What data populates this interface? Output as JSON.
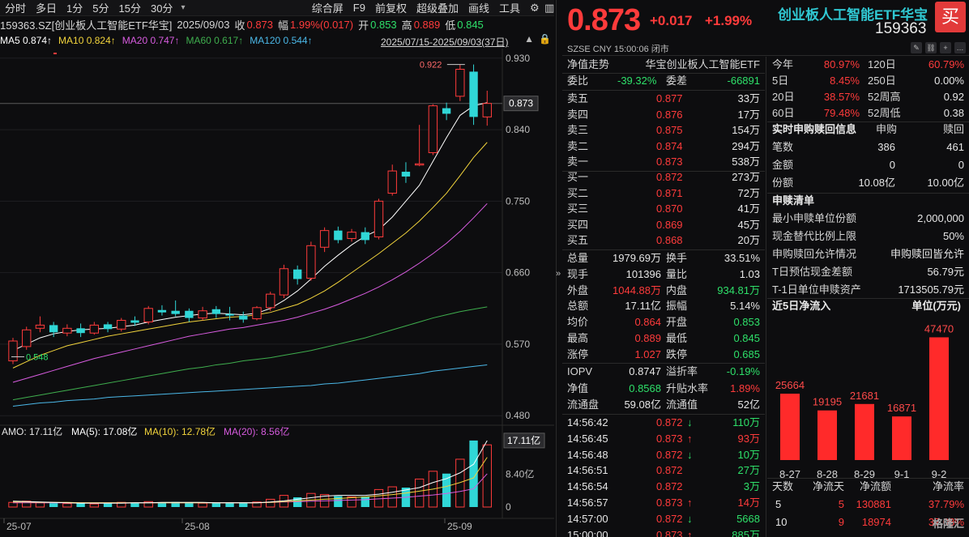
{
  "toolbar": {
    "left": [
      "分时",
      "多日",
      "1分",
      "5分",
      "15分",
      "30分"
    ],
    "right": [
      "综合屏",
      "F9",
      "前复权",
      "超级叠加",
      "画线",
      "工具"
    ]
  },
  "info": {
    "name": "159363.SZ[创业板人工智能ETF华宝]",
    "date": "2025/09/03",
    "close_label": "收",
    "close": "0.873",
    "amp_label": "幅",
    "amp": "1.99%(0.017)",
    "open_label": "开",
    "open": "0.853",
    "high_label": "高",
    "high": "0.889",
    "low_label": "低",
    "low": "0.845"
  },
  "ma": {
    "ma5": "MA5 0.874↑",
    "ma10": "MA10 0.824↑",
    "ma20": "MA20 0.747↑",
    "ma60": "MA60 0.617↑",
    "ma120": "MA120 0.544↑",
    "range": "2025/07/15-2025/09/03(37日)"
  },
  "colors": {
    "up": "#ff3b3b",
    "down": "#30d7d7",
    "ma5": "#ffffff",
    "ma10": "#f2d43c",
    "ma20": "#d85ce0",
    "ma60": "#3fae4e",
    "ma120": "#4bb8e8"
  },
  "chart_data": {
    "type": "candlestick",
    "price_axis": {
      "labels": [
        "0.930",
        "0.840",
        "0.750",
        "0.660",
        "0.570",
        "0.480"
      ],
      "current": "0.873",
      "max_label": "0.922",
      "min_label": "0.548"
    },
    "volume": {
      "title": "AMO: 17.11亿",
      "ma5": "MA(5): 17.08亿",
      "ma10": "MA(10): 12.78亿",
      "ma20": "MA(20): 8.56亿",
      "axis": [
        "17.11亿",
        "8.40亿",
        "0"
      ]
    },
    "x_labels": [
      "25-07",
      "25-08",
      "25-09"
    ],
    "candles": [
      {
        "o": 0.549,
        "c": 0.574,
        "h": 0.578,
        "l": 0.545,
        "v": 1.2
      },
      {
        "o": 0.567,
        "c": 0.588,
        "h": 0.592,
        "l": 0.563,
        "v": 1.5
      },
      {
        "o": 0.59,
        "c": 0.594,
        "h": 0.605,
        "l": 0.585,
        "v": 1.1
      },
      {
        "o": 0.594,
        "c": 0.585,
        "h": 0.598,
        "l": 0.579,
        "v": 1.0
      },
      {
        "o": 0.584,
        "c": 0.59,
        "h": 0.595,
        "l": 0.58,
        "v": 0.9
      },
      {
        "o": 0.59,
        "c": 0.584,
        "h": 0.596,
        "l": 0.579,
        "v": 1.0
      },
      {
        "o": 0.584,
        "c": 0.594,
        "h": 0.598,
        "l": 0.582,
        "v": 0.8
      },
      {
        "o": 0.595,
        "c": 0.589,
        "h": 0.598,
        "l": 0.585,
        "v": 0.9
      },
      {
        "o": 0.589,
        "c": 0.6,
        "h": 0.603,
        "l": 0.586,
        "v": 1.2
      },
      {
        "o": 0.6,
        "c": 0.597,
        "h": 0.605,
        "l": 0.593,
        "v": 1.0
      },
      {
        "o": 0.598,
        "c": 0.615,
        "h": 0.618,
        "l": 0.595,
        "v": 1.4
      },
      {
        "o": 0.613,
        "c": 0.61,
        "h": 0.619,
        "l": 0.606,
        "v": 1.1
      },
      {
        "o": 0.612,
        "c": 0.608,
        "h": 0.625,
        "l": 0.605,
        "v": 1.3
      },
      {
        "o": 0.612,
        "c": 0.603,
        "h": 0.615,
        "l": 0.598,
        "v": 1.2
      },
      {
        "o": 0.603,
        "c": 0.612,
        "h": 0.617,
        "l": 0.6,
        "v": 1.0
      },
      {
        "o": 0.614,
        "c": 0.608,
        "h": 0.618,
        "l": 0.603,
        "v": 1.1
      },
      {
        "o": 0.608,
        "c": 0.606,
        "h": 0.617,
        "l": 0.6,
        "v": 1.0
      },
      {
        "o": 0.606,
        "c": 0.601,
        "h": 0.611,
        "l": 0.597,
        "v": 1.0
      },
      {
        "o": 0.602,
        "c": 0.616,
        "h": 0.618,
        "l": 0.6,
        "v": 1.3
      },
      {
        "o": 0.616,
        "c": 0.633,
        "h": 0.636,
        "l": 0.612,
        "v": 2.0
      },
      {
        "o": 0.632,
        "c": 0.665,
        "h": 0.67,
        "l": 0.628,
        "v": 3.0
      },
      {
        "o": 0.664,
        "c": 0.652,
        "h": 0.669,
        "l": 0.645,
        "v": 2.5
      },
      {
        "o": 0.653,
        "c": 0.694,
        "h": 0.699,
        "l": 0.65,
        "v": 3.5
      },
      {
        "o": 0.692,
        "c": 0.713,
        "h": 0.717,
        "l": 0.686,
        "v": 3.2
      },
      {
        "o": 0.713,
        "c": 0.701,
        "h": 0.718,
        "l": 0.697,
        "v": 2.8
      },
      {
        "o": 0.703,
        "c": 0.711,
        "h": 0.715,
        "l": 0.699,
        "v": 2.6
      },
      {
        "o": 0.711,
        "c": 0.701,
        "h": 0.717,
        "l": 0.696,
        "v": 2.7
      },
      {
        "o": 0.705,
        "c": 0.75,
        "h": 0.753,
        "l": 0.702,
        "v": 4.5
      },
      {
        "o": 0.76,
        "c": 0.788,
        "h": 0.796,
        "l": 0.757,
        "v": 5.2
      },
      {
        "o": 0.787,
        "c": 0.781,
        "h": 0.799,
        "l": 0.773,
        "v": 5.0
      },
      {
        "o": 0.797,
        "c": 0.797,
        "h": 0.846,
        "l": 0.794,
        "v": 7.2
      },
      {
        "o": 0.811,
        "c": 0.87,
        "h": 0.872,
        "l": 0.808,
        "v": 9.2
      },
      {
        "o": 0.867,
        "c": 0.86,
        "h": 0.874,
        "l": 0.852,
        "v": 8.6
      },
      {
        "o": 0.882,
        "c": 0.916,
        "h": 0.922,
        "l": 0.876,
        "v": 12.3
      },
      {
        "o": 0.913,
        "c": 0.856,
        "h": 0.922,
        "l": 0.846,
        "v": 17.11
      },
      {
        "o": 0.856,
        "c": 0.873,
        "h": 0.889,
        "l": 0.845,
        "v": 16.0
      }
    ],
    "ma_series": {
      "ma5": [
        0.562,
        0.57,
        0.578,
        0.583,
        0.586,
        0.588,
        0.589,
        0.59,
        0.592,
        0.594,
        0.598,
        0.601,
        0.604,
        0.606,
        0.608,
        0.609,
        0.608,
        0.607,
        0.609,
        0.615,
        0.625,
        0.637,
        0.652,
        0.668,
        0.682,
        0.695,
        0.706,
        0.714,
        0.73,
        0.75,
        0.77,
        0.8,
        0.83,
        0.858,
        0.87,
        0.874
      ],
      "ma10": [
        0.54,
        0.548,
        0.556,
        0.562,
        0.568,
        0.572,
        0.576,
        0.58,
        0.583,
        0.586,
        0.589,
        0.592,
        0.595,
        0.598,
        0.6,
        0.602,
        0.604,
        0.605,
        0.607,
        0.61,
        0.615,
        0.62,
        0.628,
        0.637,
        0.648,
        0.66,
        0.672,
        0.684,
        0.697,
        0.71,
        0.725,
        0.742,
        0.76,
        0.782,
        0.805,
        0.824
      ],
      "ma20": [
        0.522,
        0.527,
        0.532,
        0.537,
        0.542,
        0.547,
        0.552,
        0.556,
        0.56,
        0.564,
        0.568,
        0.572,
        0.576,
        0.58,
        0.583,
        0.586,
        0.589,
        0.591,
        0.594,
        0.597,
        0.6,
        0.604,
        0.609,
        0.614,
        0.62,
        0.627,
        0.634,
        0.642,
        0.651,
        0.661,
        0.672,
        0.684,
        0.697,
        0.712,
        0.729,
        0.747
      ],
      "ma60": [
        0.5,
        0.503,
        0.506,
        0.509,
        0.512,
        0.515,
        0.518,
        0.521,
        0.524,
        0.527,
        0.53,
        0.533,
        0.536,
        0.539,
        0.541,
        0.544,
        0.546,
        0.549,
        0.551,
        0.553,
        0.556,
        0.559,
        0.562,
        0.566,
        0.57,
        0.574,
        0.578,
        0.583,
        0.588,
        0.593,
        0.598,
        0.603,
        0.607,
        0.611,
        0.614,
        0.617
      ],
      "ma120": [
        0.492,
        0.494,
        0.496,
        0.497,
        0.499,
        0.5,
        0.501,
        0.503,
        0.504,
        0.505,
        0.506,
        0.507,
        0.508,
        0.509,
        0.51,
        0.511,
        0.512,
        0.513,
        0.514,
        0.515,
        0.516,
        0.517,
        0.518,
        0.52,
        0.521,
        0.523,
        0.525,
        0.527,
        0.529,
        0.531,
        0.533,
        0.536,
        0.538,
        0.54,
        0.542,
        0.544
      ]
    },
    "vol_ma": {
      "ma5": [
        1.5,
        1.4,
        1.3,
        1.2,
        1.1,
        1.0,
        1.0,
        1.0,
        1.0,
        1.1,
        1.1,
        1.2,
        1.2,
        1.2,
        1.2,
        1.1,
        1.1,
        1.1,
        1.1,
        1.3,
        1.6,
        2.0,
        2.4,
        2.8,
        3.0,
        3.0,
        3.0,
        3.3,
        3.8,
        4.4,
        5.0,
        6.3,
        7.3,
        8.8,
        11.0,
        17.08
      ],
      "ma10": [
        1.3,
        1.3,
        1.2,
        1.2,
        1.2,
        1.1,
        1.1,
        1.1,
        1.1,
        1.1,
        1.1,
        1.1,
        1.1,
        1.1,
        1.1,
        1.1,
        1.1,
        1.1,
        1.1,
        1.2,
        1.4,
        1.6,
        1.8,
        2.0,
        2.2,
        2.4,
        2.6,
        2.9,
        3.2,
        3.6,
        4.1,
        4.6,
        5.3,
        6.3,
        7.5,
        12.78
      ],
      "ma20": [
        1.1,
        1.1,
        1.1,
        1.1,
        1.1,
        1.1,
        1.1,
        1.1,
        1.1,
        1.1,
        1.1,
        1.1,
        1.1,
        1.1,
        1.1,
        1.1,
        1.1,
        1.1,
        1.1,
        1.2,
        1.3,
        1.4,
        1.5,
        1.6,
        1.7,
        1.8,
        1.9,
        2.1,
        2.3,
        2.5,
        2.8,
        3.1,
        3.5,
        4.0,
        4.7,
        8.56
      ]
    }
  },
  "quote": {
    "price": "0.873",
    "change": "+0.017",
    "pct": "+1.99%",
    "name": "创业板人工智能ETF华宝",
    "code": "159363",
    "buy": "买",
    "status": "SZSE   CNY   15:00:06   闭市"
  },
  "book": {
    "title_l": "净值走势",
    "title_r": "华宝创业板人工智能ETF",
    "wb": {
      "l": "委比",
      "v": "-39.32%",
      "l2": "委差",
      "v2": "-66891"
    },
    "asks": [
      {
        "l": "卖五",
        "p": "0.877",
        "q": "33万"
      },
      {
        "l": "卖四",
        "p": "0.876",
        "q": "17万"
      },
      {
        "l": "卖三",
        "p": "0.875",
        "q": "154万"
      },
      {
        "l": "卖二",
        "p": "0.874",
        "q": "294万"
      },
      {
        "l": "卖一",
        "p": "0.873",
        "q": "538万"
      }
    ],
    "bids": [
      {
        "l": "买一",
        "p": "0.872",
        "q": "273万"
      },
      {
        "l": "买二",
        "p": "0.871",
        "q": "72万"
      },
      {
        "l": "买三",
        "p": "0.870",
        "q": "41万"
      },
      {
        "l": "买四",
        "p": "0.869",
        "q": "45万"
      },
      {
        "l": "买五",
        "p": "0.868",
        "q": "20万"
      }
    ],
    "stats": [
      {
        "l": "总量",
        "v": "1979.69万",
        "l2": "换手",
        "v2": "33.51%",
        "c": "white",
        "c2": "white"
      },
      {
        "l": "现手",
        "v": "101396",
        "l2": "量比",
        "v2": "1.03",
        "c": "white",
        "c2": "white"
      },
      {
        "l": "外盘",
        "v": "1044.88万",
        "l2": "内盘",
        "v2": "934.81万",
        "c": "red",
        "c2": "green"
      },
      {
        "l": "总额",
        "v": "17.11亿",
        "l2": "振幅",
        "v2": "5.14%",
        "c": "white",
        "c2": "white"
      },
      {
        "l": "均价",
        "v": "0.864",
        "l2": "开盘",
        "v2": "0.853",
        "c": "red",
        "c2": "green"
      },
      {
        "l": "最高",
        "v": "0.889",
        "l2": "最低",
        "v2": "0.845",
        "c": "red",
        "c2": "green"
      },
      {
        "l": "涨停",
        "v": "1.027",
        "l2": "跌停",
        "v2": "0.685",
        "c": "red",
        "c2": "green"
      }
    ],
    "iopv": [
      {
        "l": "IOPV",
        "v": "0.8747",
        "l2": "溢折率",
        "v2": "-0.19%",
        "c": "white",
        "c2": "green"
      },
      {
        "l": "净值",
        "v": "0.8568",
        "l2": "升贴水率",
        "v2": "1.89%",
        "c": "green",
        "c2": "red"
      },
      {
        "l": "流通盘",
        "v": "59.08亿",
        "l2": "流通值",
        "v2": "52亿",
        "c": "white",
        "c2": "white"
      }
    ],
    "ticks": [
      {
        "t": "14:56:42",
        "p": "0.872",
        "a": "↓",
        "q": "110万",
        "ac": "green",
        "qc": "green"
      },
      {
        "t": "14:56:45",
        "p": "0.873",
        "a": "↑",
        "q": "93万",
        "ac": "red",
        "qc": "red"
      },
      {
        "t": "14:56:48",
        "p": "0.872",
        "a": "↓",
        "q": "10万",
        "ac": "green",
        "qc": "green"
      },
      {
        "t": "14:56:51",
        "p": "0.872",
        "a": "",
        "q": "27万",
        "ac": "green",
        "qc": "green"
      },
      {
        "t": "14:56:54",
        "p": "0.872",
        "a": "",
        "q": "3万",
        "ac": "green",
        "qc": "green"
      },
      {
        "t": "14:56:57",
        "p": "0.873",
        "a": "↑",
        "q": "14万",
        "ac": "red",
        "qc": "red"
      },
      {
        "t": "14:57:00",
        "p": "0.872",
        "a": "↓",
        "q": "5668",
        "ac": "green",
        "qc": "green"
      },
      {
        "t": "15:00:00",
        "p": "0.873",
        "a": "↑",
        "q": "885万",
        "ac": "red",
        "qc": "green"
      }
    ]
  },
  "side": {
    "perf": [
      {
        "l": "今年",
        "v": "80.97%",
        "l2": "120日",
        "v2": "60.79%",
        "c": "red",
        "c2": "red"
      },
      {
        "l": "5日",
        "v": "8.45%",
        "l2": "250日",
        "v2": "0.00%",
        "c": "red",
        "c2": "white"
      },
      {
        "l": "20日",
        "v": "38.57%",
        "l2": "52周高",
        "v2": "0.92",
        "c": "red",
        "c2": "white"
      },
      {
        "l": "60日",
        "v": "79.48%",
        "l2": "52周低",
        "v2": "0.38",
        "c": "red",
        "c2": "white"
      }
    ],
    "realtime": {
      "title": "实时申购赎回信息",
      "h1": "申购",
      "h2": "赎回",
      "rows": [
        {
          "l": "笔数",
          "v": "386",
          "v2": "461"
        },
        {
          "l": "金额",
          "v": "0",
          "v2": "0"
        },
        {
          "l": "份额",
          "v": "10.08亿",
          "v2": "10.00亿"
        }
      ]
    },
    "list": {
      "title": "申赎清单",
      "rows": [
        {
          "l": "最小申赎单位份额",
          "v": "2,000,000"
        },
        {
          "l": "现金替代比例上限",
          "v": "50%"
        },
        {
          "l": "申购赎回允许情况",
          "v": "申购赎回皆允许"
        },
        {
          "l": "T日预估现金差额",
          "v": "56.79元"
        },
        {
          "l": "T-1日单位申赎资产",
          "v": "1713505.79元"
        }
      ]
    },
    "flow": {
      "title": "近5日净流入",
      "unit": "单位(万元)",
      "bars": [
        {
          "d": "8-27",
          "v": 25664
        },
        {
          "d": "8-28",
          "v": 19195
        },
        {
          "d": "8-29",
          "v": 21681
        },
        {
          "d": "9-1",
          "v": 16871
        },
        {
          "d": "9-2",
          "v": 47470
        }
      ]
    },
    "flow_table": {
      "h": [
        "天数",
        "净流天",
        "净流额",
        "净流率"
      ],
      "rows": [
        [
          "5",
          "5",
          "130881",
          "37.79%"
        ],
        [
          "10",
          "9",
          "18974",
          "37.08%"
        ]
      ]
    },
    "watermark": "格隆汇"
  }
}
